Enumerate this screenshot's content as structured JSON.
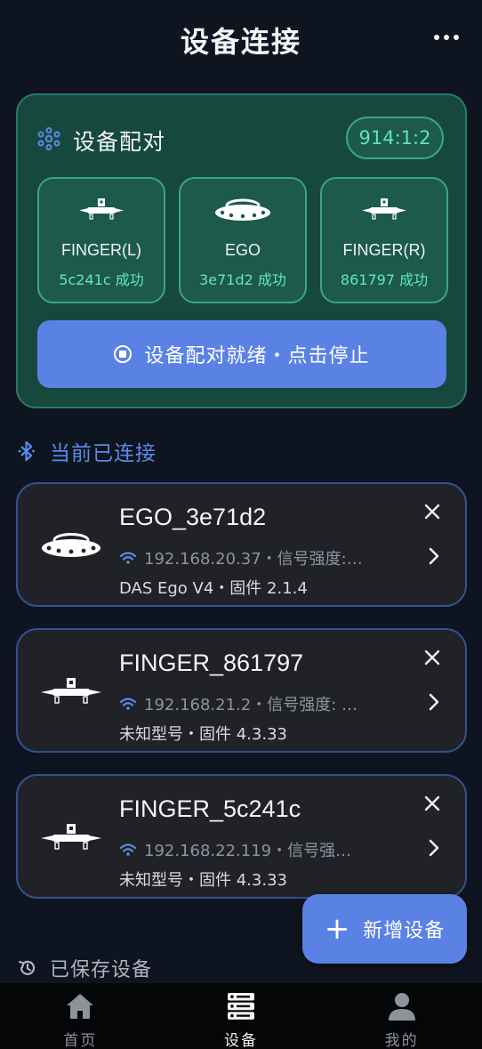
{
  "header": {
    "title": "设备连接"
  },
  "pairing": {
    "title": "设备配对",
    "badge": "914:1:2",
    "devices": [
      {
        "name": "FINGER(L)",
        "status": "5c241c 成功",
        "icon": "finger-device-icon"
      },
      {
        "name": "EGO",
        "status": "3e71d2 成功",
        "icon": "ego-device-icon"
      },
      {
        "name": "FINGER(R)",
        "status": "861797 成功",
        "icon": "finger-device-icon"
      }
    ],
    "stop_button": "设备配对就绪・点击停止"
  },
  "connected": {
    "label": "当前已连接",
    "items": [
      {
        "name": "EGO_3e71d2",
        "meta": "192.168.20.37・信号强度:…",
        "model": "DAS Ego V4・固件 2.1.4",
        "icon": "ego-device-icon"
      },
      {
        "name": "FINGER_861797",
        "meta": "192.168.21.2・信号强度: …",
        "model": "未知型号・固件 4.3.33",
        "icon": "finger-device-icon"
      },
      {
        "name": "FINGER_5c241c",
        "meta": "192.168.22.119・信号强…",
        "model": "未知型号・固件 4.3.33",
        "icon": "finger-device-icon"
      }
    ]
  },
  "saved": {
    "label": "已保存设备"
  },
  "fab": {
    "label": "新增设备"
  },
  "nav": [
    {
      "label": "首页",
      "icon": "home-icon"
    },
    {
      "label": "设备",
      "icon": "devices-icon"
    },
    {
      "label": "我的",
      "icon": "profile-icon"
    }
  ],
  "colors": {
    "accent": "#5a82e4",
    "pair_bg": "#16483e",
    "success": "#62e6c0",
    "card_bg": "#202227"
  }
}
